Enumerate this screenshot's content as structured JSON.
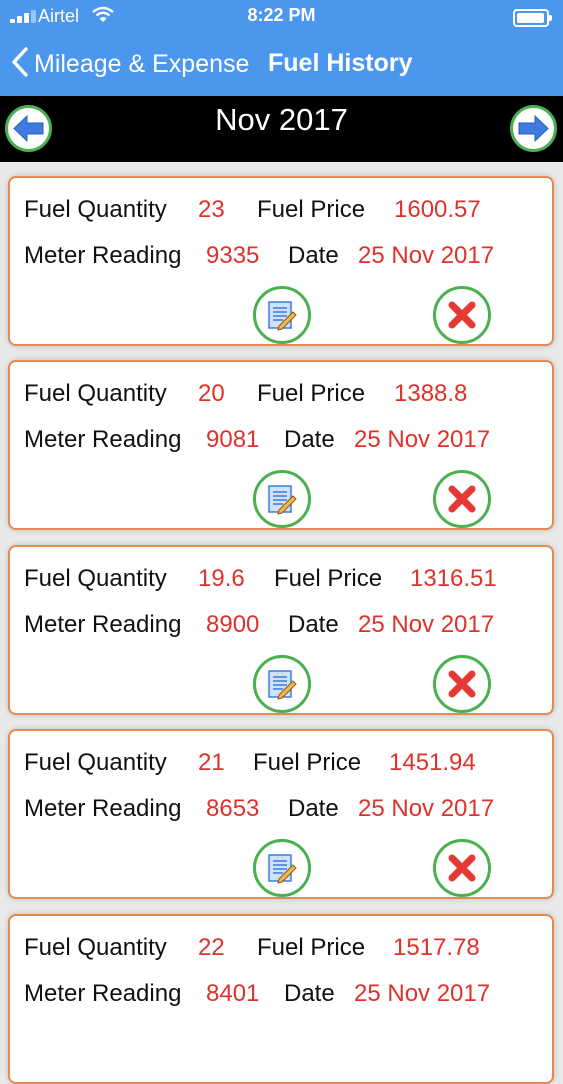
{
  "status": {
    "carrier": "Airtel",
    "time": "8:22 PM"
  },
  "nav": {
    "back_label": "Mileage & Expense",
    "title": "Fuel History"
  },
  "month_bar": {
    "month": "Nov 2017"
  },
  "labels": {
    "fuel_quantity": "Fuel Quantity",
    "fuel_price": "Fuel Price",
    "meter_reading": "Meter Reading",
    "date": "Date"
  },
  "entries": [
    {
      "fuel_quantity": "23",
      "fuel_price": "1600.57",
      "meter_reading": "9335",
      "date": "25 Nov 2017"
    },
    {
      "fuel_quantity": "20",
      "fuel_price": "1388.8",
      "meter_reading": "9081",
      "date": "25 Nov 2017"
    },
    {
      "fuel_quantity": "19.6",
      "fuel_price": "1316.51",
      "meter_reading": "8900",
      "date": "25 Nov 2017"
    },
    {
      "fuel_quantity": "21",
      "fuel_price": "1451.94",
      "meter_reading": "8653",
      "date": "25 Nov 2017"
    },
    {
      "fuel_quantity": "22",
      "fuel_price": "1517.78",
      "meter_reading": "8401",
      "date": "25 Nov 2017"
    }
  ],
  "icons": {
    "back": "chevron-left-icon",
    "prev_month": "arrow-left-icon",
    "next_month": "arrow-right-icon",
    "edit": "edit-note-icon",
    "delete": "delete-x-icon"
  },
  "colors": {
    "nav_blue": "#4c97ee",
    "value_red": "#e0312b",
    "card_border": "#e58a50",
    "button_ring": "#4caf50",
    "arrow_blue": "#3d7be0",
    "delete_red": "#e53935"
  }
}
